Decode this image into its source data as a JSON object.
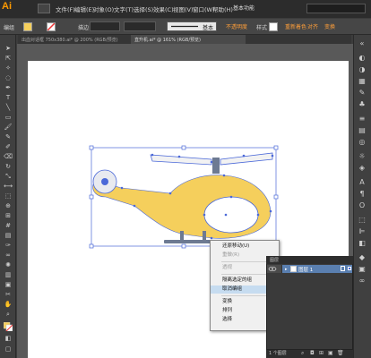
{
  "app": {
    "logo": "Ai"
  },
  "menubar": {
    "items": [
      "文件(F)",
      "编辑(E)",
      "对象(O)",
      "文字(T)",
      "选择(S)",
      "效果(C)",
      "视图(V)",
      "窗口(W)",
      "帮助(H)"
    ],
    "workspace": "基本功能"
  },
  "controlbar": {
    "selection_label": "编组",
    "stroke_label": "描边",
    "style_label": "样式",
    "basic_label": "基本",
    "opacity_label": "不透明度",
    "recolor_label": "重新着色",
    "align_label": "对齐",
    "transform_label": "变换"
  },
  "tabs": [
    "出血对话框 750x380.ai* @ 200% (RGB/预览)",
    "直升机.ai* @ 161% (RGB/预览)"
  ],
  "context_menu": {
    "items": [
      {
        "label": "还原移动(U)",
        "disabled": false,
        "submenu": false
      },
      {
        "label": "重做(R)",
        "disabled": true,
        "submenu": false
      },
      {
        "label": "透视",
        "disabled": true,
        "submenu": true
      },
      {
        "label": "隔离选定的组",
        "disabled": false,
        "submenu": false
      },
      {
        "label": "取消编组",
        "disabled": false,
        "submenu": false,
        "highlighted": true
      },
      {
        "label": "变换",
        "disabled": false,
        "submenu": true
      },
      {
        "label": "排列",
        "disabled": false,
        "submenu": true
      },
      {
        "label": "选择",
        "disabled": false,
        "submenu": true
      }
    ]
  },
  "layers_panel": {
    "tab": "图层",
    "layer_name": "图层 1",
    "count": "1 个图层"
  },
  "colors": {
    "helicopter_body": "#f5cf5c",
    "skids": "#6d7a92",
    "selection": "#4a68d8",
    "accent": "#ff9a00"
  }
}
